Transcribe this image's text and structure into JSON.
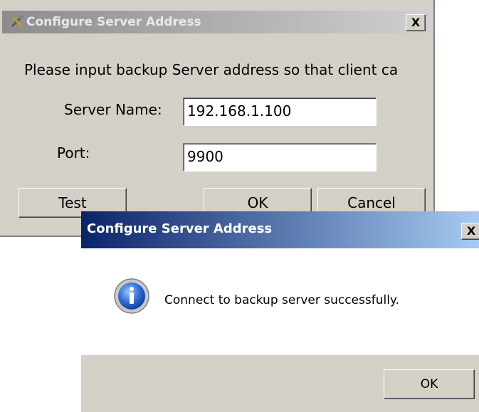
{
  "config_dialog": {
    "title": "Configure Server Address",
    "close_label": "X",
    "instruction": "Please input backup Server address so that client ca",
    "server_name_label": "Server Name:",
    "server_name_value": "192.168.1.100",
    "port_label": "Port:",
    "port_value": "9900",
    "test_label": "Test",
    "ok_label": "OK",
    "cancel_label": "Cancel"
  },
  "message_box": {
    "title": "Configure Server Address",
    "close_label": "X",
    "icon": "info-icon",
    "message": "Connect to backup server successfully.",
    "ok_label": "OK"
  }
}
